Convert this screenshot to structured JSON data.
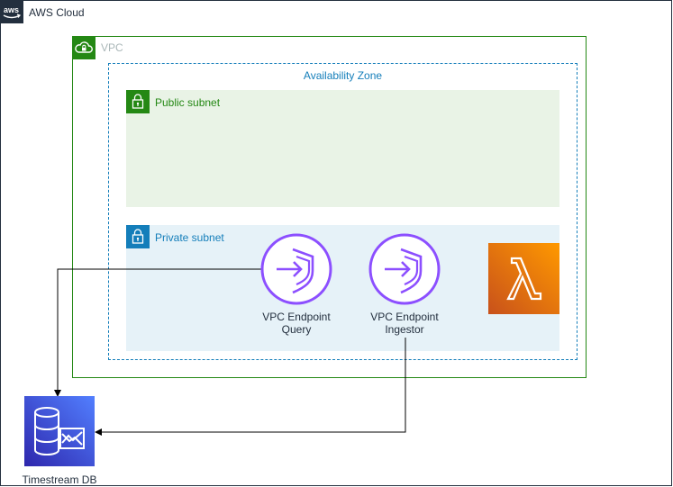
{
  "diagram": {
    "aws_cloud": {
      "label": "AWS Cloud"
    },
    "vpc": {
      "label": "VPC"
    },
    "availability_zone": {
      "label": "Availability Zone"
    },
    "public_subnet": {
      "label": "Public subnet"
    },
    "private_subnet": {
      "label": "Private subnet"
    },
    "endpoint_query": {
      "line1": "VPC Endpoint",
      "line2": "Query"
    },
    "endpoint_ingestor": {
      "line1": "VPC Endpoint",
      "line2": "Ingestor"
    },
    "timestream": {
      "label": "Timestream DB"
    }
  },
  "icons": {
    "aws_cloud": "aws-logo-icon",
    "vpc": "cloud-lock-icon",
    "public_subnet": "padlock-icon",
    "private_subnet": "padlock-icon",
    "endpoint_query": "vpc-endpoint-icon",
    "endpoint_ingestor": "vpc-endpoint-icon",
    "lambda": "lambda-icon",
    "timestream": "timestream-icon"
  },
  "colors": {
    "aws_dark": "#232f3e",
    "vpc_green": "#248814",
    "az_blue": "#147eba",
    "public_fill": "#e9f3e6",
    "private_fill": "#e6f2f8",
    "endpoint_purple": "#8c4fff",
    "lambda_orange": "#ed7100",
    "timestream_blue": "#3b48cc",
    "label_grey": "#aab7b8"
  }
}
